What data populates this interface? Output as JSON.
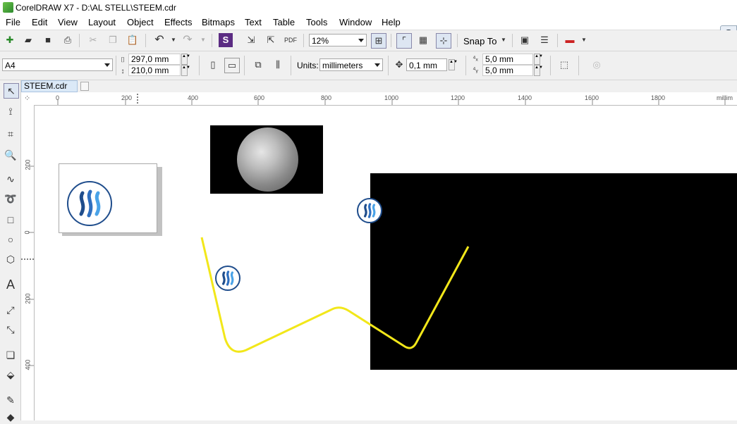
{
  "window": {
    "title": "CorelDRAW X7 - D:\\AL STELL\\STEEM.cdr"
  },
  "menu": [
    "File",
    "Edit",
    "View",
    "Layout",
    "Object",
    "Effects",
    "Bitmaps",
    "Text",
    "Table",
    "Tools",
    "Window",
    "Help"
  ],
  "search_badge": "S",
  "standard_toolbar": {
    "zoom": "12%",
    "snap_to": "Snap To"
  },
  "property_bar": {
    "page_size": "A4",
    "width": "297,0 mm",
    "height": "210,0 mm",
    "units_label": "Units:",
    "units": "millimeters",
    "nudge": "0,1 mm",
    "dup_x": "5,0 mm",
    "dup_y": "5,0 mm"
  },
  "tabs": [
    {
      "label": "STEEM.cdr"
    }
  ],
  "ruler_h": [
    "0",
    "200",
    "400",
    "600",
    "800",
    "1000",
    "1200",
    "1400",
    "1600",
    "1800",
    "millim"
  ],
  "ruler_v": [
    "200",
    "0",
    "200",
    "400"
  ],
  "icons": {
    "app": "coreldraw-icon",
    "steem": "steem-logo-icon",
    "moon": "moon-image"
  },
  "colors": {
    "curve": "#f2e71a",
    "steem_blue": "#1f4d8c",
    "steem_light": "#4aa3e8"
  }
}
